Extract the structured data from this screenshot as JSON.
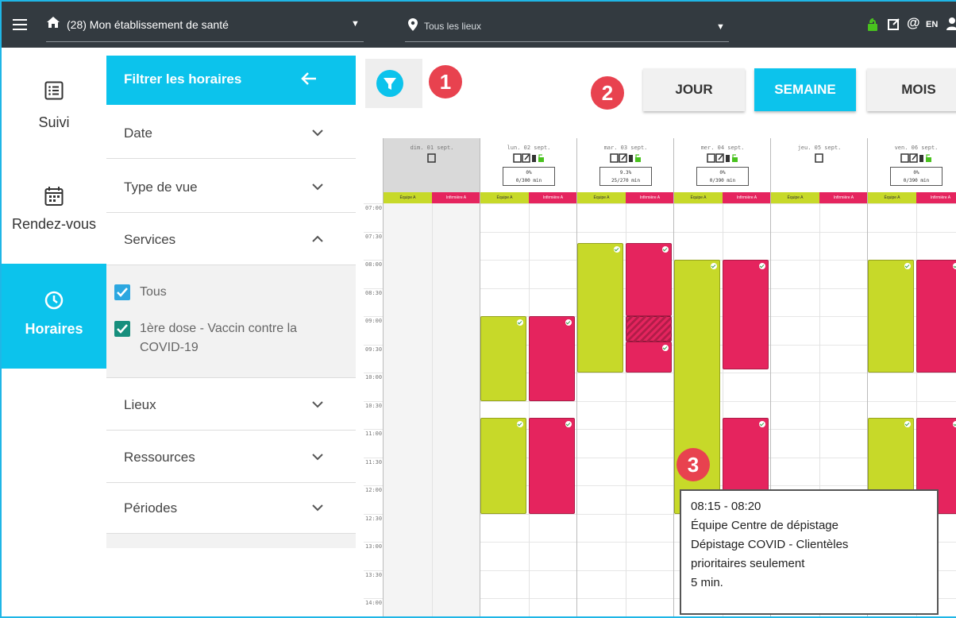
{
  "topbar": {
    "establishment": "(28) Mon établissement de santé",
    "location": "Tous les lieux",
    "lang": "EN"
  },
  "nav": {
    "suivi": "Suivi",
    "rdv": "Rendez-vous",
    "horaires": "Horaires"
  },
  "filter_panel": {
    "title": "Filtrer les horaires",
    "sections": {
      "date": "Date",
      "type_vue": "Type de vue",
      "services": "Services",
      "lieux": "Lieux",
      "ressources": "Ressources",
      "periodes": "Périodes"
    },
    "services_options": {
      "tous": "Tous",
      "vaccin_line1": "1ère dose - Vaccin contre la",
      "vaccin_line2": "COVID-19"
    }
  },
  "markers": {
    "m1": "1",
    "m2": "2",
    "m3": "3"
  },
  "views": {
    "jour": "JOUR",
    "semaine": "SEMAINE",
    "mois": "MOIS"
  },
  "calendar": {
    "times": [
      "07:00",
      "07:30",
      "08:00",
      "08:30",
      "09:00",
      "09:30",
      "10:00",
      "10:30",
      "11:00",
      "11:30",
      "12:00",
      "12:30",
      "13:00",
      "13:30",
      "14:00"
    ],
    "days": [
      {
        "date": "dim. 01 sept.",
        "pct": "",
        "min": ""
      },
      {
        "date": "lun. 02 sept.",
        "pct": "0%",
        "min": "0/300 min"
      },
      {
        "date": "mar. 03 sept.",
        "pct": "9.3%",
        "min": "25/270 min"
      },
      {
        "date": "mer. 04 sept.",
        "pct": "0%",
        "min": "0/390 min"
      },
      {
        "date": "jeu. 05 sept.",
        "pct": "",
        "min": ""
      },
      {
        "date": "ven. 06 sept.",
        "pct": "0%",
        "min": "0/390 min"
      }
    ],
    "resource_a": "Équipe A",
    "resource_b": "Infirmière A",
    "colors": {
      "green": "#c7d929",
      "pink": "#e5245e",
      "accent": "#0cc3ec",
      "marker": "#e8424f"
    }
  },
  "tooltip": {
    "time": "08:15 - 08:20",
    "team": "Équipe Centre de dépistage",
    "service_line1": "Dépistage COVID - Clientèles",
    "service_line2": "prioritaires seulement",
    "duration": "5 min."
  }
}
